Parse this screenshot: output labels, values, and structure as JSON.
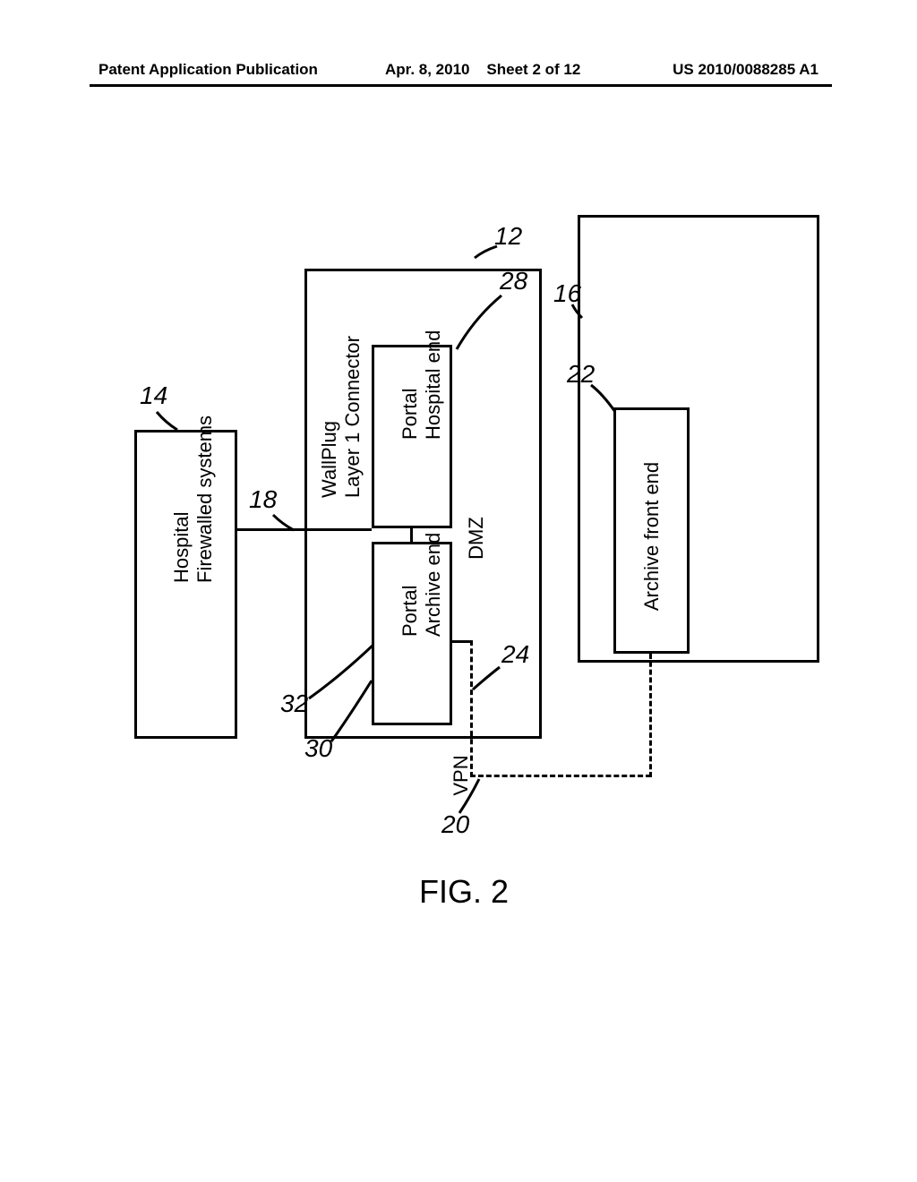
{
  "header": {
    "left": "Patent Application Publication",
    "date": "Apr. 8, 2010",
    "sheet": "Sheet 2 of 12",
    "pubno": "US 2010/0088285 A1"
  },
  "boxes": {
    "hospital_line1": "Hospital",
    "hospital_line2": "Firewalled systems",
    "wallplug_line1": "WallPlug",
    "wallplug_line2": "Layer 1 Connector",
    "portal_hosp_line1": "Portal",
    "portal_hosp_line2": "Hospital end",
    "portal_arch_line1": "Portal",
    "portal_arch_line2": "Archive end",
    "archive_front": "Archive front end"
  },
  "labels": {
    "dmz": "DMZ",
    "vpn": "VPN"
  },
  "refs": {
    "r12": "12",
    "r14": "14",
    "r16": "16",
    "r18": "18",
    "r20": "20",
    "r22": "22",
    "r24": "24",
    "r28": "28",
    "r30": "30",
    "r32": "32"
  },
  "caption": "FIG. 2"
}
